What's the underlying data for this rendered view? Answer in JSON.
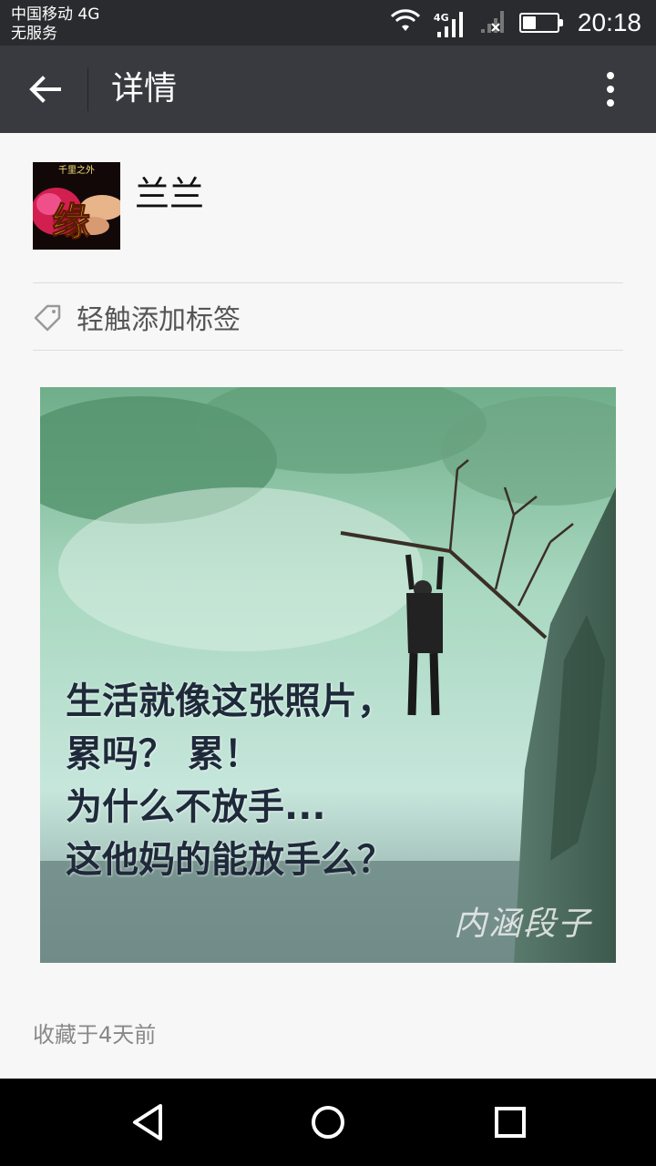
{
  "status_bar": {
    "carrier_line1": "中国移动 4G",
    "carrier_line2": "无服务",
    "network_badge": "4G",
    "time": "20:18",
    "battery_level": 0.36,
    "icons": [
      "wifi-icon",
      "signal-4g-icon",
      "signal-no-service-icon",
      "battery-icon"
    ]
  },
  "app_bar": {
    "title": "详情",
    "back_icon": "arrow-left-icon",
    "more_icon": "more-vertical-icon"
  },
  "profile": {
    "avatar_text_top": "千里之外",
    "avatar_text_main": "缘",
    "name": "兰兰"
  },
  "tag": {
    "icon": "tag-icon",
    "label": "轻触添加标签"
  },
  "post_image": {
    "lines": [
      "生活就像这张照片，",
      "累吗？ 累！",
      "为什么不放手...",
      "这他妈的能放手么？"
    ],
    "watermark": "内涵段子"
  },
  "saved_time": "收藏于4天前",
  "nav_bar": {
    "icons": [
      "back-triangle-icon",
      "home-circle-icon",
      "recents-square-icon"
    ]
  },
  "colors": {
    "status_bar_bg": "#2a2b2e",
    "app_bar_bg": "#393a3f",
    "page_bg": "#f7f7f7",
    "nav_bar_bg": "#000000"
  }
}
